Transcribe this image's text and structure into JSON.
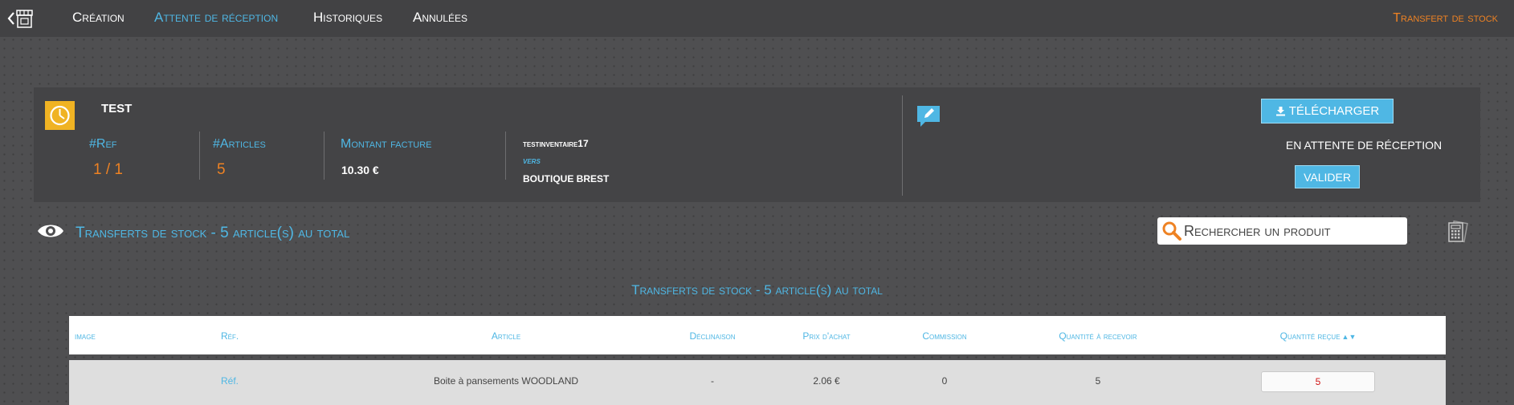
{
  "nav": {
    "items": [
      {
        "label": "Création",
        "active": false
      },
      {
        "label": "Attente de réception",
        "active": true
      },
      {
        "label": "Historiques",
        "active": false
      },
      {
        "label": "Annulées",
        "active": false
      }
    ],
    "module_title": "Transfert de stock"
  },
  "transfer": {
    "name": "TEST",
    "ref_label": "#Ref",
    "ref_value": "1 / 1",
    "articles_label": "#Articles",
    "articles_value": "5",
    "amount_label": "Montant facture",
    "amount_value": "10.30 €",
    "from": "testinventaire17",
    "to_label": "vers",
    "to": "BOUTIQUE BREST",
    "download_label": "Télécharger",
    "status": "En attente de réception",
    "validate_label": "Valider"
  },
  "section": {
    "title": "Transferts de stock - 5 article(s) au total",
    "search_placeholder": "Rechercher un produit"
  },
  "table": {
    "title": "Transferts de stock - 5 article(s) au total",
    "columns": [
      "image",
      "Réf.",
      "Article",
      "Déclinaison",
      "Prix d'achat",
      "Commission",
      "Quantité à recevoir",
      "Quantité reçue"
    ],
    "sort_arrows": "▲▼",
    "rows": [
      {
        "image": "",
        "ref": "Réf.",
        "article": "Boite à pansements WOODLAND",
        "declinaison": "-",
        "prix": "2.06 €",
        "commission": "0",
        "qty_to_receive": "5",
        "qty_received": "5"
      }
    ]
  },
  "colors": {
    "accent_blue": "#4fb7e4",
    "accent_orange": "#ee8223",
    "badge_yellow": "#f0b323",
    "qty_red": "#d01515"
  },
  "icons": {
    "back": "chevron-left-icon",
    "shop": "shop-icon",
    "clock": "clock-icon",
    "comment": "comment-edit-icon",
    "download": "download-icon",
    "eye": "eye-icon",
    "search": "search-icon",
    "calculator": "calculator-icon"
  }
}
